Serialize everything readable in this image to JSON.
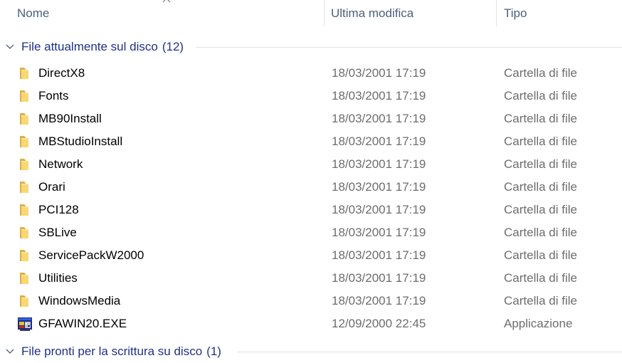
{
  "columns": {
    "name": "Nome",
    "modified": "Ultima modifica",
    "type": "Tipo"
  },
  "groups": [
    {
      "label": "File attualmente sul disco",
      "count": "(12)",
      "expanded": true
    },
    {
      "label": "File pronti per la scrittura su disco",
      "count": "(1)",
      "expanded": true
    }
  ],
  "files": [
    {
      "name": "DirectX8",
      "modified": "18/03/2001 17:19",
      "type": "Cartella di file",
      "icon": "folder-icon"
    },
    {
      "name": "Fonts",
      "modified": "18/03/2001 17:19",
      "type": "Cartella di file",
      "icon": "folder-icon"
    },
    {
      "name": "MB90Install",
      "modified": "18/03/2001 17:19",
      "type": "Cartella di file",
      "icon": "folder-icon"
    },
    {
      "name": "MBStudioInstall",
      "modified": "18/03/2001 17:19",
      "type": "Cartella di file",
      "icon": "folder-icon"
    },
    {
      "name": "Network",
      "modified": "18/03/2001 17:19",
      "type": "Cartella di file",
      "icon": "folder-icon"
    },
    {
      "name": "Orari",
      "modified": "18/03/2001 17:19",
      "type": "Cartella di file",
      "icon": "folder-icon"
    },
    {
      "name": "PCI128",
      "modified": "18/03/2001 17:19",
      "type": "Cartella di file",
      "icon": "folder-icon"
    },
    {
      "name": "SBLive",
      "modified": "18/03/2001 17:19",
      "type": "Cartella di file",
      "icon": "folder-icon"
    },
    {
      "name": "ServicePackW2000",
      "modified": "18/03/2001 17:19",
      "type": "Cartella di file",
      "icon": "folder-icon"
    },
    {
      "name": "Utilities",
      "modified": "18/03/2001 17:19",
      "type": "Cartella di file",
      "icon": "folder-icon"
    },
    {
      "name": "WindowsMedia",
      "modified": "18/03/2001 17:19",
      "type": "Cartella di file",
      "icon": "folder-icon"
    },
    {
      "name": "GFAWIN20.EXE",
      "modified": "12/09/2000 22:45",
      "type": "Applicazione",
      "icon": "application-icon"
    }
  ],
  "colors": {
    "header_text": "#4c607a",
    "group_text": "#1e3287",
    "secondary_text": "#6d6d6d",
    "folder_yellow": "#f8d775"
  }
}
